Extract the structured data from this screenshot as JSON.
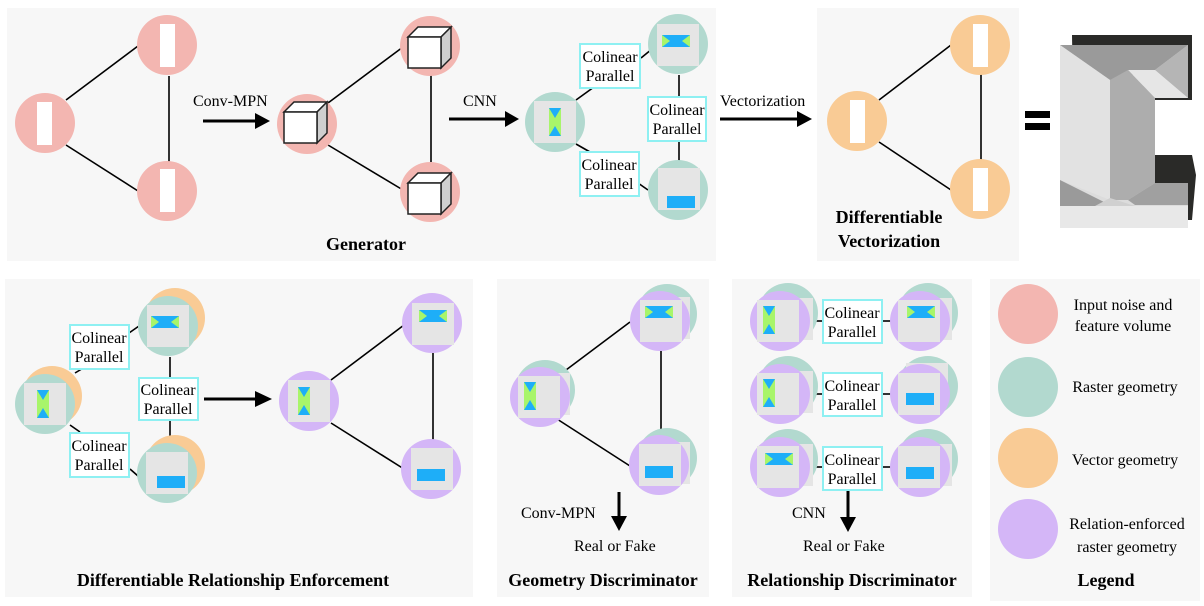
{
  "colors": {
    "input_noise": "#f3b6b1",
    "raster": "#b2d9cf",
    "vector": "#f9cb95",
    "relation_enforced": "#d4b6f7",
    "relation_box_border": "#8ef0f2",
    "shape_blue": "#1eaef8",
    "shape_green": "#a8f56a",
    "tile_gray": "#e5e5e5",
    "panel_bg": "#f7f7f7"
  },
  "icons": {
    "feature_volume": "cube-icon",
    "vertical_bar": "white-bar-icon",
    "hourglass": "hourglass-shape-icon",
    "bowtie": "bowtie-shape-icon",
    "bar": "horizontal-bar-icon",
    "building": "building-3d-icon",
    "equals": "equals-icon"
  },
  "generator": {
    "title": "Generator",
    "arrow1_label": "Conv-MPN",
    "arrow2_label": "CNN",
    "relation_labels": [
      [
        "Colinear",
        "Parallel"
      ],
      [
        "Colinear",
        "Parallel"
      ],
      [
        "Colinear",
        "Parallel"
      ]
    ]
  },
  "vectorization": {
    "arrow_label": "Vectorization",
    "title_line1": "Differentiable",
    "title_line2": "Vectorization",
    "equals": "="
  },
  "enforcement": {
    "title": "Differentiable Relationship Enforcement",
    "relation_labels": [
      [
        "Colinear",
        "Parallel"
      ],
      [
        "Colinear",
        "Parallel"
      ],
      [
        "Colinear",
        "Parallel"
      ]
    ]
  },
  "geometry_discriminator": {
    "title": "Geometry Discriminator",
    "arrow_label": "Conv-MPN",
    "output": "Real or Fake"
  },
  "relationship_discriminator": {
    "title": "Relationship Discriminator",
    "arrow_label": "CNN",
    "output": "Real or Fake",
    "relation_labels": [
      [
        "Colinear",
        "Parallel"
      ],
      [
        "Colinear",
        "Parallel"
      ],
      [
        "Colinear",
        "Parallel"
      ]
    ]
  },
  "legend": {
    "title": "Legend",
    "items": [
      {
        "line1": "Input noise and",
        "line2": "feature volume"
      },
      {
        "line1": "Raster geometry",
        "line2": ""
      },
      {
        "line1": "Vector geometry",
        "line2": ""
      },
      {
        "line1": "Relation-enforced",
        "line2": "raster geometry"
      }
    ]
  }
}
